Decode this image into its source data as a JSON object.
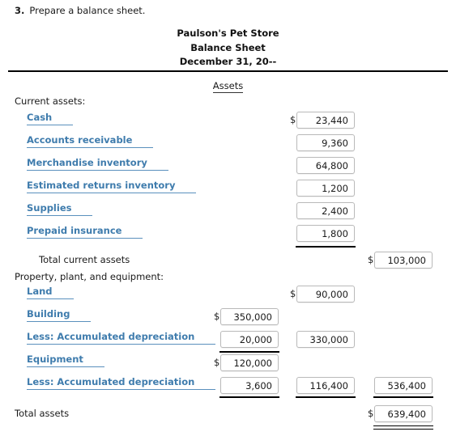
{
  "question": {
    "number": "3.",
    "text": "Prepare a balance sheet."
  },
  "statement": {
    "company": "Paulson's Pet Store",
    "title": "Balance Sheet",
    "date": "December 31, 20--",
    "section_heading": "Assets"
  },
  "groups": {
    "current_assets_header": "Current assets:",
    "ppe_header": "Property, plant, and equipment:",
    "total_current_assets_label": "Total current assets",
    "total_assets_label": "Total assets"
  },
  "rows": {
    "cash": {
      "label": "Cash",
      "amount": "23,440",
      "dollar": "$"
    },
    "accounts_receivable": {
      "label": "Accounts receivable",
      "amount": "9,360"
    },
    "merchandise_inventory": {
      "label": "Merchandise inventory",
      "amount": "64,800"
    },
    "estimated_returns_inventory": {
      "label": "Estimated returns inventory",
      "amount": "1,200"
    },
    "supplies": {
      "label": "Supplies",
      "amount": "2,400"
    },
    "prepaid_insurance": {
      "label": "Prepaid insurance",
      "amount": "1,800"
    },
    "total_current_assets": {
      "amount": "103,000",
      "dollar": "$"
    },
    "land": {
      "label": "Land",
      "amount": "90,000",
      "dollar": "$"
    },
    "building": {
      "label": "Building",
      "amount": "350,000",
      "dollar": "$"
    },
    "building_accum_dep": {
      "label": "Less: Accumulated depreciation",
      "amount": "20,000",
      "net": "330,000"
    },
    "equipment": {
      "label": "Equipment",
      "amount": "120,000",
      "dollar": "$"
    },
    "equipment_accum_dep": {
      "label": "Less: Accumulated depreciation",
      "amount": "3,600",
      "net": "116,400",
      "total_ppe": "536,400"
    },
    "total_assets": {
      "amount": "639,400",
      "dollar": "$"
    }
  },
  "colors": {
    "fill_label": "#3f7cad",
    "fill_underline": "#5a90bd",
    "rule": "#000000",
    "box_border": "#b9b9b9"
  }
}
